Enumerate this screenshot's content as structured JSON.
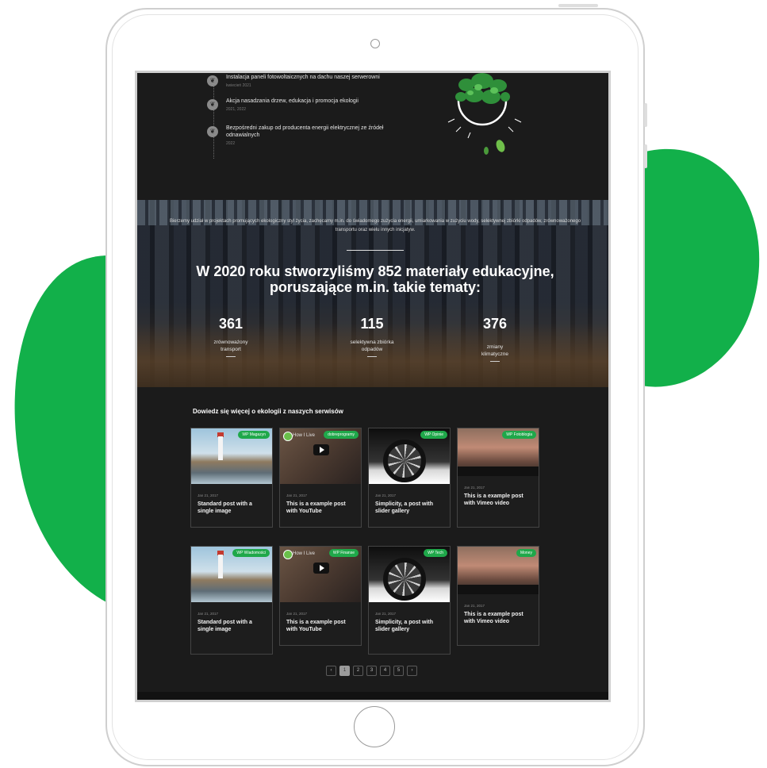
{
  "timeline": {
    "items": [
      {
        "title": "Instalacja paneli fotowoltaicznych na dachu naszej serwerowni",
        "date": "kwiecień 2021"
      },
      {
        "title": "Akcja nasadzania drzew, edukacja i promocja ekologii",
        "date": "2021, 2022"
      },
      {
        "title": "Bezpośredni zakup od producenta energii elektrycznej ze źródeł odnawialnych",
        "date": "2022"
      }
    ]
  },
  "hero": {
    "intro": "Bierzemy udział w projektach promujących ekologiczny styl życia, zachęcamy m.in. do świadomego zużycia energii, umiarkowania w zużyciu wody, selektywnej zbiórki odpadów, zrównoważonego transportu oraz wielu innych inicjatyw.",
    "title": "W 2020 roku stworzyliśmy 852 materiały edukacyjne, poruszające m.in. takie tematy:",
    "stats": [
      {
        "value": "361",
        "label": "zrównoważony transport"
      },
      {
        "value": "115",
        "label": "selektywna zbiórka odpadów"
      },
      {
        "value": "376",
        "label": "zmiany klimatyczne"
      }
    ]
  },
  "blog": {
    "heading": "Dowiedz się więcej o ekologii z naszych serwisów",
    "video_label": "How I Live",
    "cards": [
      {
        "badge": "WP Magazyn",
        "date": "Jan 21, 2017",
        "title": "Standard post with a single image"
      },
      {
        "badge": "dobreprogramy",
        "date": "Jan 21, 2017",
        "title": "This is a example post with YouTube"
      },
      {
        "badge": "WP Opinie",
        "date": "Jan 21, 2017",
        "title": "Simplicity, a post with slider gallery"
      },
      {
        "badge": "WP Fotoblogia",
        "date": "Jan 21, 2017",
        "title": "This is a example post with Vimeo video"
      },
      {
        "badge": "WP Wiadomości",
        "date": "Jan 21, 2017",
        "title": "Standard post with a single image"
      },
      {
        "badge": "WP Finanse",
        "date": "Jan 21, 2017",
        "title": "This is a example post with YouTube"
      },
      {
        "badge": "WP Tech",
        "date": "Jan 21, 2017",
        "title": "Simplicity, a post with slider gallery"
      },
      {
        "badge": "Money",
        "date": "Jan 21, 2017",
        "title": "This is a example post with Vimeo video"
      }
    ]
  },
  "pagination": {
    "prev": "‹",
    "pages": [
      "1",
      "2",
      "3",
      "4",
      "5"
    ],
    "next": "›",
    "current": "1"
  },
  "colors": {
    "accent": "#12b04a",
    "badge": "#1fa84a",
    "screen_bg": "#1b1b1b"
  }
}
